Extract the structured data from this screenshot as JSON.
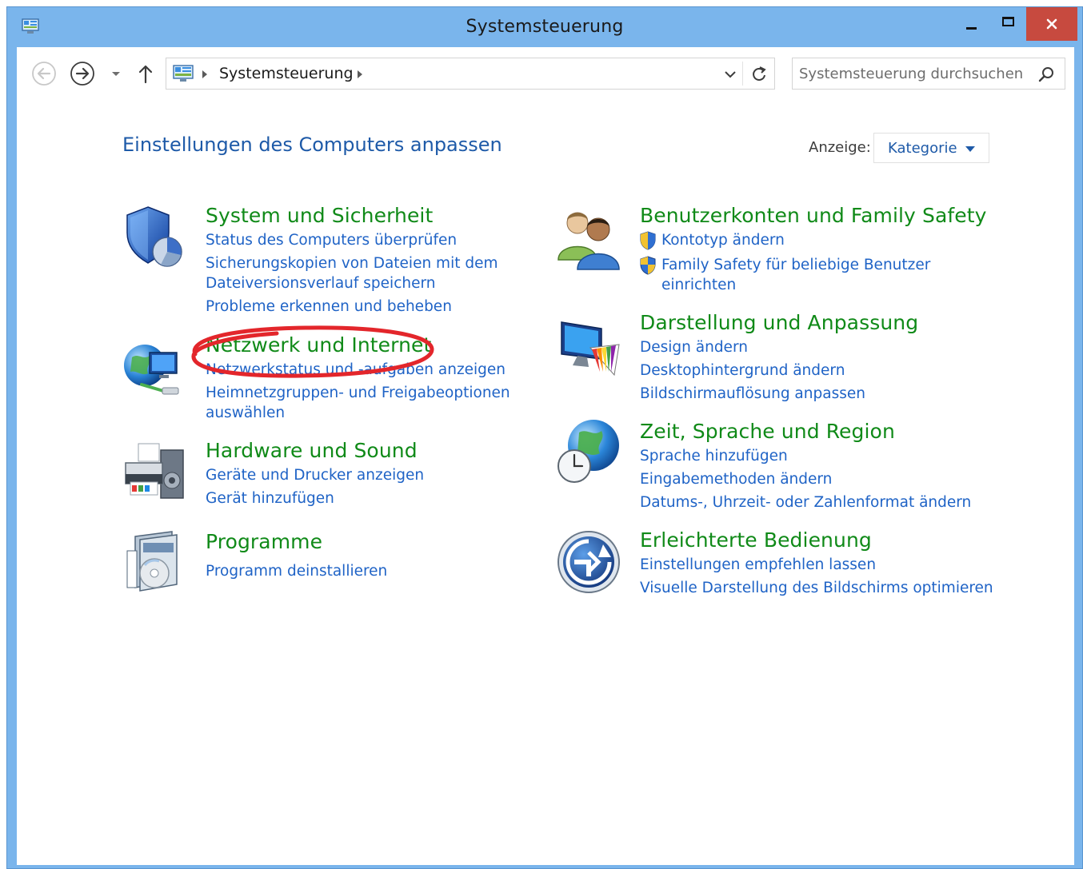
{
  "window": {
    "title": "Systemsteuerung"
  },
  "address_bar": {
    "path_item": "Systemsteuerung"
  },
  "search": {
    "placeholder": "Systemsteuerung durchsuchen"
  },
  "header": {
    "title": "Einstellungen des Computers anpassen",
    "view_label": "Anzeige:",
    "view_value": "Kategorie"
  },
  "categories": [
    {
      "title": "System und Sicherheit",
      "icon": "shield-security-icon",
      "links": [
        "Status des Computers überprüfen",
        "Sicherungskopien von Dateien mit dem",
        "Dateiversionsverlauf speichern",
        "Probleme erkennen und beheben"
      ]
    },
    {
      "title": "Netzwerk und Internet",
      "icon": "network-globe-icon",
      "links": [
        "Netzwerkstatus und -aufgaben anzeigen",
        "Heimnetzgruppen- und Freigabeoptionen",
        "auswählen"
      ]
    },
    {
      "title": "Hardware und Sound",
      "icon": "printer-speaker-icon",
      "links": [
        "Geräte und Drucker anzeigen",
        "Gerät hinzufügen"
      ]
    },
    {
      "title": "Programme",
      "icon": "programs-disc-icon",
      "links": [
        "Programm deinstallieren"
      ]
    },
    {
      "title": "Benutzerkonten und Family Safety",
      "icon": "user-accounts-icon",
      "links": [
        "Kontotyp ändern",
        "Family Safety für beliebige Benutzer",
        "einrichten"
      ]
    },
    {
      "title": "Darstellung und Anpassung",
      "icon": "display-personalization-icon",
      "links": [
        "Design ändern",
        "Desktophintergrund ändern",
        "Bildschirmauflösung anpassen"
      ]
    },
    {
      "title": "Zeit, Sprache und Region",
      "icon": "globe-clock-icon",
      "links": [
        "Sprache hinzufügen",
        "Eingabemethoden ändern",
        "Datums-, Uhrzeit- oder Zahlenformat ändern"
      ]
    },
    {
      "title": "Erleichterte Bedienung",
      "icon": "ease-of-access-icon",
      "links": [
        "Einstellungen empfehlen lassen",
        "Visuelle Darstellung des Bildschirms optimieren"
      ]
    }
  ],
  "colors": {
    "titlebar": "#7ab5ec",
    "close_button": "#c74a3f",
    "category_title": "#108a18",
    "link": "#1f63c6",
    "header": "#1e5aa8",
    "annotation": "#e3262b"
  }
}
